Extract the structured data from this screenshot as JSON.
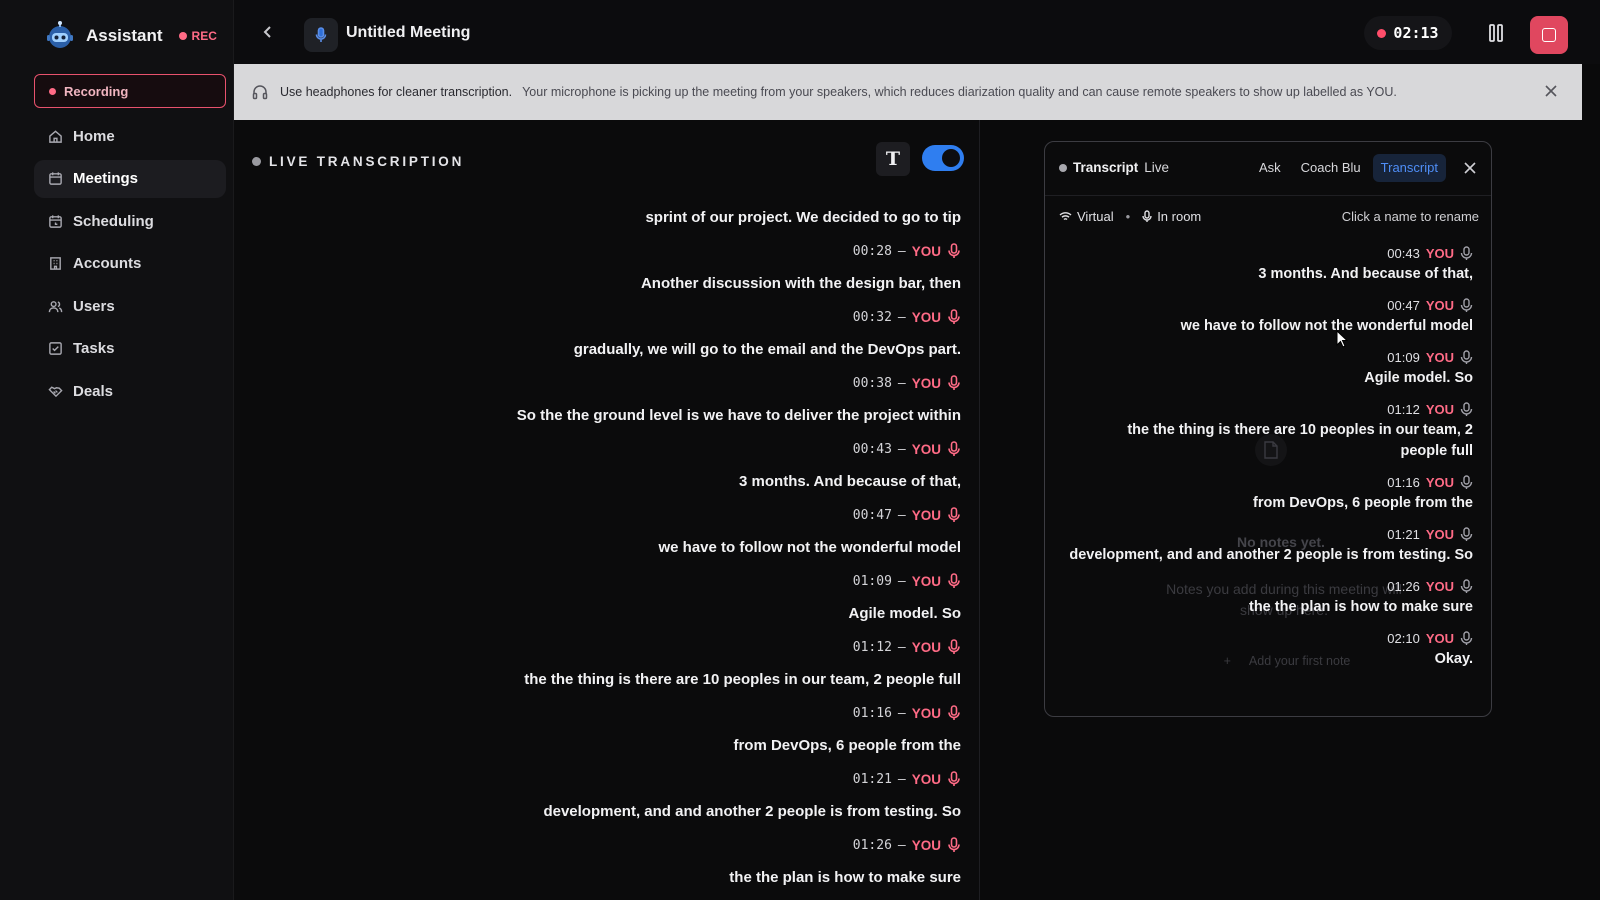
{
  "app": {
    "name": "Assistant",
    "rec_label": "REC"
  },
  "sidebar": {
    "recording_label": "Recording",
    "items": [
      {
        "label": "Home",
        "icon": "home-icon"
      },
      {
        "label": "Meetings",
        "icon": "calendar-icon",
        "active": true
      },
      {
        "label": "Scheduling",
        "icon": "calendar-clock-icon"
      },
      {
        "label": "Accounts",
        "icon": "building-icon"
      },
      {
        "label": "Users",
        "icon": "users-icon"
      },
      {
        "label": "Tasks",
        "icon": "checkbox-icon"
      },
      {
        "label": "Deals",
        "icon": "handshake-icon"
      }
    ]
  },
  "header": {
    "title": "Untitled Meeting",
    "timer": "02:13"
  },
  "banner": {
    "strong": "Use headphones for cleaner transcription.",
    "text": "Your microphone is picking up the meeting from your speakers, which reduces diarization quality and can cause remote speakers to show up labelled as YOU."
  },
  "live": {
    "label": "LIVE TRANSCRIPTION",
    "font_button": "T",
    "segments": [
      {
        "text": "sprint of our project. We decided to go to tip",
        "time": "00:28",
        "speaker": "YOU"
      },
      {
        "text": "Another discussion with the design bar, then",
        "time": "00:32",
        "speaker": "YOU"
      },
      {
        "text": "gradually, we will go to the email and the DevOps part.",
        "time": "00:38",
        "speaker": "YOU"
      },
      {
        "text": "So the the ground level is we have to deliver the project within",
        "time": "00:43",
        "speaker": "YOU"
      },
      {
        "text": "3 months. And because of that,",
        "time": "00:47",
        "speaker": "YOU"
      },
      {
        "text": "we have to follow not the wonderful model",
        "time": "01:09",
        "speaker": "YOU"
      },
      {
        "text": "Agile model. So",
        "time": "01:12",
        "speaker": "YOU"
      },
      {
        "text": "the the thing is there are 10 peoples in our team, 2 people full",
        "time": "01:16",
        "speaker": "YOU"
      },
      {
        "text": "from DevOps, 6 people from the",
        "time": "01:21",
        "speaker": "YOU"
      },
      {
        "text": "development, and and another 2 people is from testing. So",
        "time": "01:26",
        "speaker": "YOU"
      },
      {
        "text": "the the plan is how to make sure",
        "time": "",
        "speaker": ""
      }
    ]
  },
  "panel": {
    "title": "Transcript",
    "live_label": "Live",
    "tabs": [
      {
        "label": "Ask"
      },
      {
        "label": "Coach Blu"
      },
      {
        "label": "Transcript",
        "active": true
      }
    ],
    "sources": {
      "virtual": "Virtual",
      "in_room": "In room"
    },
    "rename_hint": "Click a name to rename",
    "empty_title": "No notes yet.",
    "empty_text": "Notes you add during this meeting will show up here.",
    "add_note": "Add your first note",
    "entries": [
      {
        "time": "00:43",
        "speaker": "YOU",
        "text": "3 months. And because of that,"
      },
      {
        "time": "00:47",
        "speaker": "YOU",
        "text": "we have to follow not the wonderful model"
      },
      {
        "time": "01:09",
        "speaker": "YOU",
        "text": "Agile model. So"
      },
      {
        "time": "01:12",
        "speaker": "YOU",
        "text": "the the thing is there are 10 peoples in our team, 2 people full"
      },
      {
        "time": "01:16",
        "speaker": "YOU",
        "text": "from DevOps, 6 people from the"
      },
      {
        "time": "01:21",
        "speaker": "YOU",
        "text": "development, and and another 2 people is from testing. So"
      },
      {
        "time": "01:26",
        "speaker": "YOU",
        "text": "the the plan is how to make sure"
      },
      {
        "time": "02:10",
        "speaker": "YOU",
        "text": "Okay."
      }
    ]
  },
  "colors": {
    "accent": "#2f7ef0",
    "you": "#ff6b86",
    "stop": "#e0475f"
  }
}
